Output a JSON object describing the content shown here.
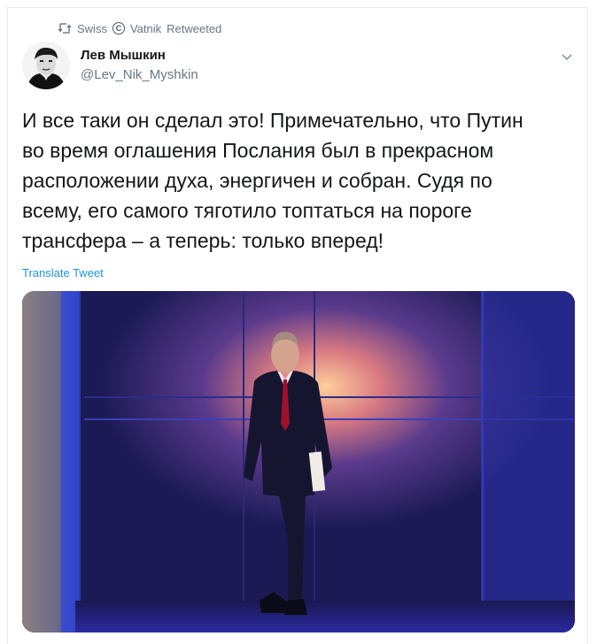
{
  "retweet": {
    "source": "Swiss",
    "retweeter": "Vatnik",
    "label": "Retweeted"
  },
  "author": {
    "name": "Лев Мышкин",
    "handle": "@Lev_Nik_Myshkin"
  },
  "tweet": {
    "text": "И все таки он сделал это! Примечательно, что Путин\nво время оглашения Послания был в прекрасном\nрасположении духа, энергичен и собран. Судя по\nвсему, его самого тяготило топтаться на пороге\nтрансфера – а теперь: только вперед!",
    "translate_label": "Translate Tweet"
  },
  "icons": {
    "retweet": "retweet-icon",
    "copyright": "copyright-icon",
    "caret": "chevron-down-icon"
  },
  "colors": {
    "link": "#1b95e0",
    "secondary_text": "#657786",
    "primary_text": "#14171a"
  }
}
